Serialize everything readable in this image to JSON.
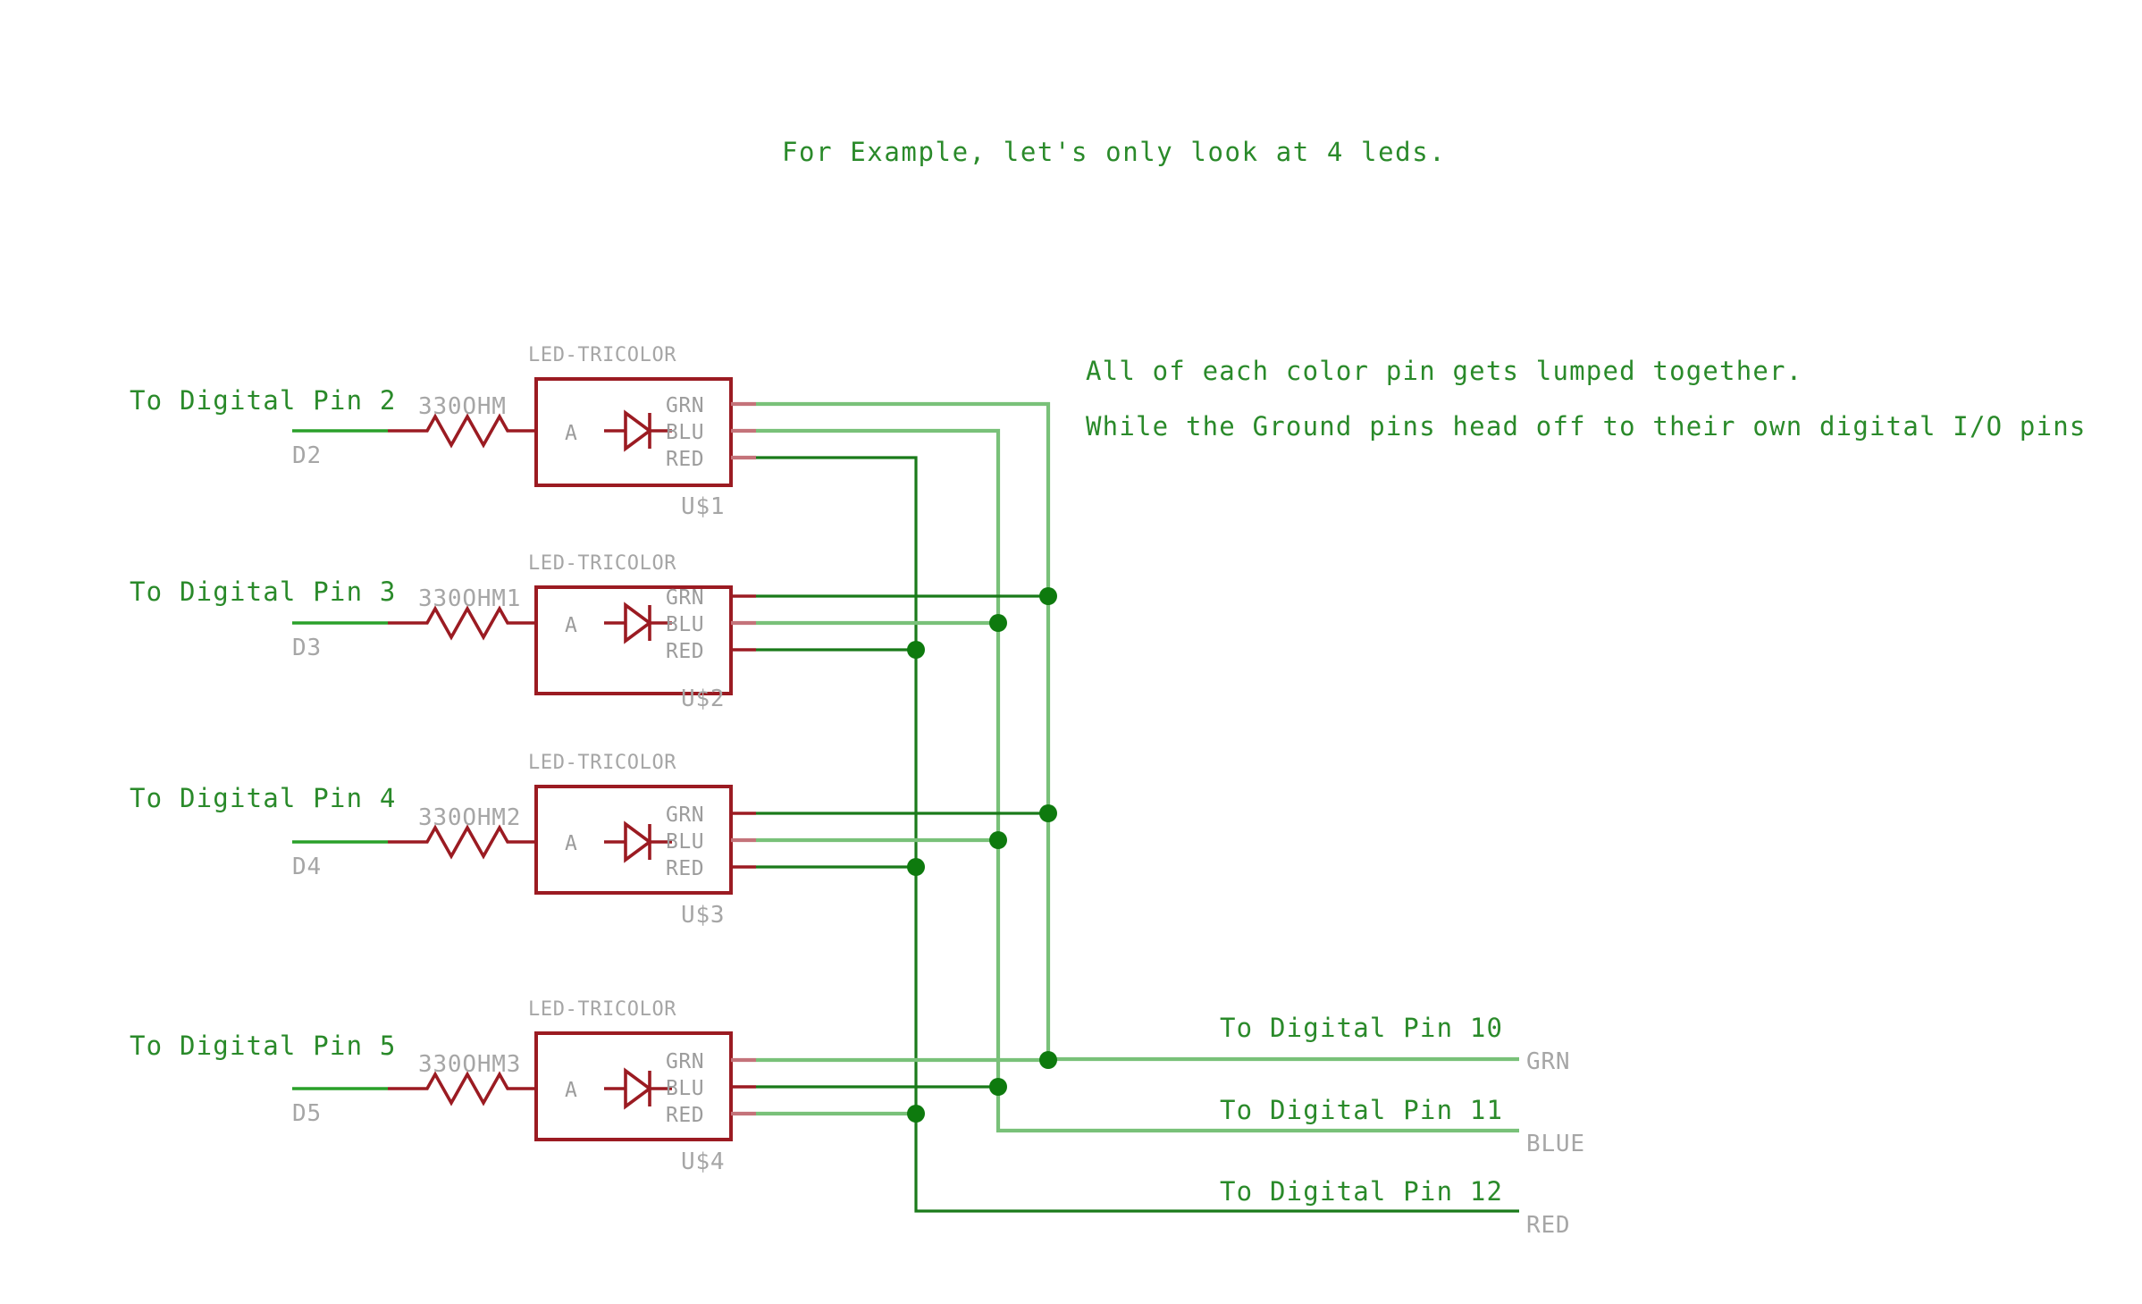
{
  "title": "For Example, let's only look at 4 leds.",
  "annotations": [
    "All of each color pin gets lumped together.",
    "While the Ground pins head off to their own digital I/O pins"
  ],
  "component_label": "LED-TRICOLOR",
  "pin_labels": {
    "anode": "A",
    "green": "GRN",
    "blue": "BLU",
    "red": "RED"
  },
  "leds": [
    {
      "input_label": "To Digital Pin 2",
      "net_label": "D2",
      "resistor_label": "330OHM",
      "designator": "U$1",
      "part": "LED-TRICOLOR"
    },
    {
      "input_label": "To Digital Pin 3",
      "net_label": "D3",
      "resistor_label": "330OHM1",
      "designator": "U$2",
      "part": "LED-TRICOLOR"
    },
    {
      "input_label": "To Digital Pin 4",
      "net_label": "D4",
      "resistor_label": "330OHM2",
      "designator": "U$3",
      "part": "LED-TRICOLOR"
    },
    {
      "input_label": "To Digital Pin 5",
      "net_label": "D5",
      "resistor_label": "330OHM3",
      "designator": "U$4",
      "part": "LED-TRICOLOR"
    }
  ],
  "outputs": [
    {
      "pin_label": "To Digital Pin 10",
      "net_label": "GRN"
    },
    {
      "pin_label": "To Digital Pin 11",
      "net_label": "BLUE"
    },
    {
      "pin_label": "To Digital Pin 12",
      "net_label": "RED"
    }
  ],
  "colors": {
    "wire_green": "#1a7a1a",
    "wire_green_light": "#79c179",
    "device_red": "#9b1b22",
    "label_gray": "#a6a6a6",
    "text_green": "#2a8a2a",
    "background": "#ffffff"
  }
}
